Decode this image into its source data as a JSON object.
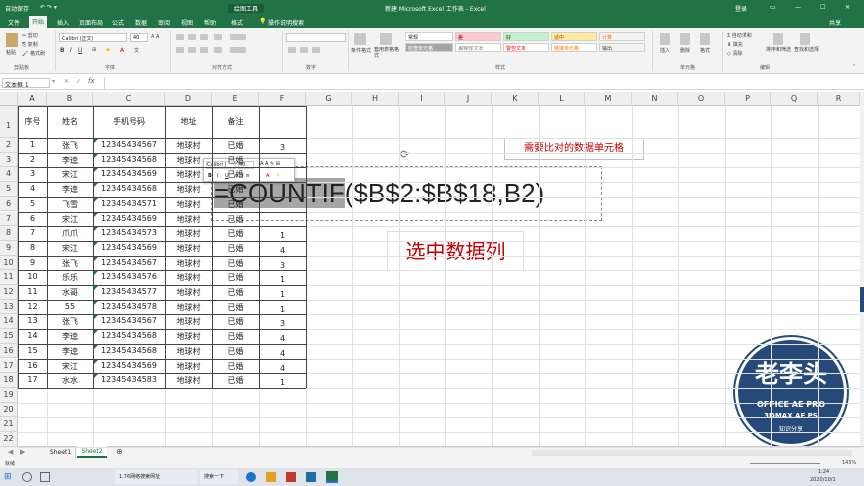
{
  "titlebar": {
    "quick_access": "自动保存",
    "context_tool": "绘图工具",
    "doc_title": "新建 Microsoft Excel 工作表 - Excel",
    "login": "登录"
  },
  "tabs": [
    "文件",
    "开始",
    "插入",
    "页面布局",
    "公式",
    "数据",
    "审阅",
    "视图",
    "帮助",
    "格式",
    "操作说明搜索"
  ],
  "share": "共享",
  "ribbon": {
    "clipboard": {
      "paste": "粘贴",
      "cut": "剪切",
      "copy": "复制",
      "painter": "格式刷",
      "label": "剪贴板"
    },
    "font": {
      "name": "Calibri (正文)",
      "size": "40",
      "label": "字体"
    },
    "alignment": {
      "label": "对齐方式"
    },
    "number": {
      "label": "数字"
    },
    "styles": {
      "cond": "条件格式",
      "table": "套用表格格式",
      "items": [
        "常规",
        "差",
        "好",
        "适中",
        "计算",
        "检查单元格",
        "解释性文本",
        "警告文本",
        "链接单元格",
        "输出"
      ],
      "label": "样式"
    },
    "cells": {
      "insert": "插入",
      "delete": "删除",
      "format": "格式",
      "label": "单元格"
    },
    "editing": {
      "autosum": "自动求和",
      "fill": "填充",
      "clear": "清除",
      "sort": "排序和筛选",
      "find": "查找和选择",
      "label": "编辑"
    }
  },
  "formula_bar": {
    "name_box": "文本框 1",
    "fx": "fx"
  },
  "columns": [
    "A",
    "B",
    "C",
    "D",
    "E",
    "F",
    "G",
    "H",
    "I",
    "J",
    "K",
    "L",
    "M",
    "N",
    "O",
    "P",
    "Q",
    "R"
  ],
  "rows": [
    "1",
    "2",
    "3",
    "4",
    "5",
    "6",
    "7",
    "8",
    "9",
    "10",
    "11",
    "12",
    "13",
    "14",
    "15",
    "16",
    "17",
    "18",
    "19",
    "20",
    "21",
    "22"
  ],
  "table": {
    "headers": [
      "序号",
      "姓名",
      "手机号码",
      "地址",
      "备注"
    ],
    "data": [
      [
        "1",
        "张飞",
        "12345434567",
        "地球村",
        "已婚",
        "3"
      ],
      [
        "2",
        "李逵",
        "12345434568",
        "地球村",
        "已婚",
        ""
      ],
      [
        "3",
        "宋江",
        "12345434569",
        "地球村",
        "已婚",
        ""
      ],
      [
        "4",
        "李逵",
        "12345434568",
        "地球村",
        "已婚",
        ""
      ],
      [
        "5",
        "飞雪",
        "12345434571",
        "地球村",
        "已婚",
        ""
      ],
      [
        "6",
        "宋江",
        "12345434569",
        "地球村",
        "已婚",
        ""
      ],
      [
        "7",
        "爪爪",
        "12345434573",
        "地球村",
        "已婚",
        "1"
      ],
      [
        "8",
        "宋江",
        "12345434569",
        "地球村",
        "已婚",
        "4"
      ],
      [
        "9",
        "张飞",
        "12345434567",
        "地球村",
        "已婚",
        "3"
      ],
      [
        "10",
        "乐乐",
        "12345434576",
        "地球村",
        "已婚",
        "1"
      ],
      [
        "11",
        "水哥",
        "12345434577",
        "地球村",
        "已婚",
        "1"
      ],
      [
        "12",
        "55",
        "12345434578",
        "地球村",
        "已婚",
        "1"
      ],
      [
        "13",
        "张飞",
        "12345434567",
        "地球村",
        "已婚",
        "3"
      ],
      [
        "14",
        "李逵",
        "12345434568",
        "地球村",
        "已婚",
        "4"
      ],
      [
        "15",
        "李逵",
        "12345434568",
        "地球村",
        "已婚",
        "4"
      ],
      [
        "16",
        "宋江",
        "12345434569",
        "地球村",
        "已婚",
        "4"
      ],
      [
        "17",
        "水水",
        "12345434583",
        "地球村",
        "已婚",
        "1"
      ]
    ]
  },
  "mini_toolbar": {
    "font": "Calibri (",
    "size": "40"
  },
  "formula_text": {
    "highlighted": "=COUNTIF",
    "rest": "($B$2:$B$18,B2)"
  },
  "annotations": {
    "red_box": "需要比对的数据单元格",
    "select": "选中数据列"
  },
  "sheets": [
    "Sheet1",
    "Sheet2"
  ],
  "status": {
    "mode": "就绪",
    "zoom": "145%"
  },
  "watermark": {
    "main": "老李头",
    "line1": "OFFICE AE PRO",
    "line2": "3DMAX AE PS",
    "line3": "知识分享"
  },
  "taskbar": {
    "item1": "1.76网络搜索网址",
    "item2": "搜索一下",
    "time": "1:24",
    "date": "2020/10/1"
  },
  "colors": {
    "excel_green": "#217346",
    "red": "#c00000"
  }
}
